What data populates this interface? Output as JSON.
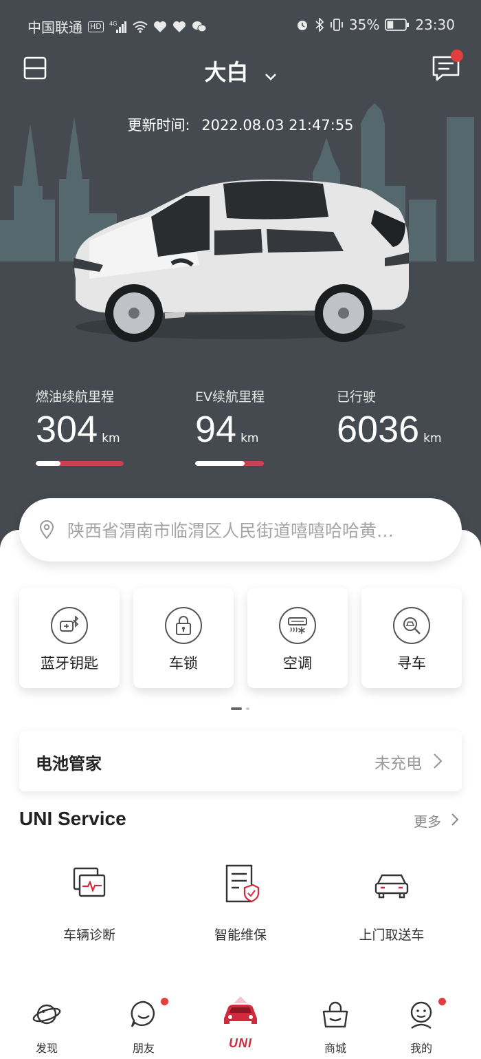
{
  "status_bar": {
    "carrier": "中国联通",
    "hd": "HD",
    "network": "4G",
    "battery_pct": "35%",
    "battery_level": 0.35,
    "time": "23:30"
  },
  "header": {
    "car_name": "大白",
    "has_unread": true
  },
  "update": {
    "label": "更新时间:",
    "time": "2022.08.03 21:47:55"
  },
  "stats": [
    {
      "label": "燃油续航里程",
      "value": "304",
      "unit": "km",
      "bar_fill": 0.28
    },
    {
      "label": "EV续航里程",
      "value": "94",
      "unit": "km",
      "bar_fill": 0.72
    },
    {
      "label": "已行驶",
      "value": "6036",
      "unit": "km"
    }
  ],
  "location": {
    "address": "陕西省渭南市临渭区人民街道嘻嘻哈哈黄…"
  },
  "quick_actions": [
    {
      "label": "蓝牙钥匙",
      "icon": "bluetooth-key-icon"
    },
    {
      "label": "车锁",
      "icon": "lock-icon"
    },
    {
      "label": "空调",
      "icon": "air-conditioner-icon"
    },
    {
      "label": "寻车",
      "icon": "find-car-icon"
    }
  ],
  "battery": {
    "title": "电池管家",
    "status": "未充电"
  },
  "uni_service": {
    "title": "UNI Service",
    "more": "更多",
    "items": [
      {
        "label": "车辆诊断",
        "icon": "diagnosis-icon"
      },
      {
        "label": "智能维保",
        "icon": "maintenance-icon"
      },
      {
        "label": "上门取送车",
        "icon": "pickup-car-icon"
      }
    ]
  },
  "tabbar": {
    "items": [
      {
        "label": "发现",
        "icon": "planet-icon"
      },
      {
        "label": "朋友",
        "icon": "chat-smile-icon",
        "badge": true
      },
      {
        "label": "UNI",
        "icon": "uni-car-icon"
      },
      {
        "label": "商城",
        "icon": "shopping-bag-icon"
      },
      {
        "label": "我的",
        "icon": "profile-icon",
        "badge": true
      }
    ]
  },
  "colors": {
    "hero_bg": "#444a4f",
    "accent_red": "#d02a3d",
    "badge_red": "#e23d3f"
  }
}
